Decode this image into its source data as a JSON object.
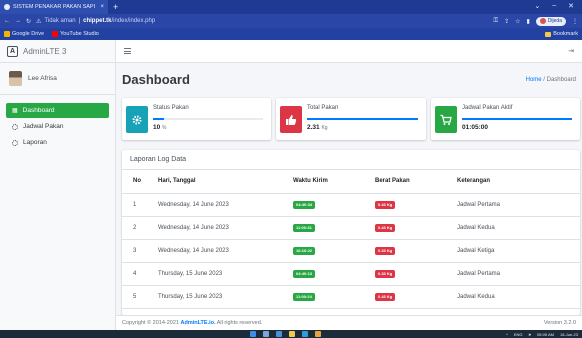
{
  "browser": {
    "tab_title": "SISTEM PENAKAR PAKAN SAPI",
    "tab_close": "×",
    "new_tab": "+",
    "url_secure": "Tidak aman",
    "url_host": "chippet.tk",
    "url_path": "/index/index.php",
    "profile_label": "Dijeda",
    "bookmarks": [
      {
        "label": "Google Drive",
        "icon": "google-drive-icon",
        "color": "#f4b400"
      },
      {
        "label": "YouTube Studio",
        "icon": "youtube-icon",
        "color": "#ff0000"
      }
    ],
    "bookmarks_right": "Bookmark"
  },
  "brand": {
    "logo_letter": "A",
    "name": "AdminLTE 3"
  },
  "user": {
    "name": "Lee Afrisa"
  },
  "menu": [
    {
      "label": "Dashboard",
      "active": true
    },
    {
      "label": "Jadwal Pakan",
      "active": false
    },
    {
      "label": "Laporan",
      "active": false
    }
  ],
  "header": {
    "title": "Dashboard",
    "breadcrumb_home": "Home",
    "breadcrumb_sep": "/",
    "breadcrumb_current": "Dashboard"
  },
  "info_boxes": [
    {
      "label": "Status Pakan",
      "value": "10",
      "unit": "%",
      "color": "#17a2b8",
      "icon": "gear-icon",
      "progress": 0.1
    },
    {
      "label": "Total Pakan",
      "value": "2.31",
      "unit": "Kg",
      "color": "#dc3545",
      "icon": "thumbs-up-icon",
      "progress": 1.0
    },
    {
      "label": "Jadwal Pakan Aktif",
      "value": "01:05:00",
      "unit": "",
      "color": "#28a745",
      "icon": "cart-icon",
      "progress": 1.0
    }
  ],
  "log": {
    "title": "Laporan Log Data",
    "columns": [
      "No",
      "Hari, Tanggal",
      "Waktu Kirim",
      "Berat Pakan",
      "Keterangan"
    ],
    "rows": [
      {
        "no": "1",
        "date": "Wednesday, 14 June 2023",
        "time": "04:40:34",
        "weight": "0.43 Kg",
        "note": "Jadwal Pertama"
      },
      {
        "no": "2",
        "date": "Wednesday, 14 June 2023",
        "time": "11:00:31",
        "weight": "0.43 Kg",
        "note": "Jadwal Kedua"
      },
      {
        "no": "3",
        "date": "Wednesday, 14 June 2023",
        "time": "16:10:22",
        "weight": "0.33 Kg",
        "note": "Jadwal Ketiga"
      },
      {
        "no": "4",
        "date": "Thursday, 15 June 2023",
        "time": "04:40:13",
        "weight": "0.33 Kg",
        "note": "Jadwal Pertama"
      },
      {
        "no": "5",
        "date": "Thursday, 15 June 2023",
        "time": "11:00:24",
        "weight": "0.43 Kg",
        "note": "Jadwal Kedua"
      }
    ]
  },
  "footer": {
    "copyright": "Copyright © 2014-2021",
    "brand": "AdminLTE.io.",
    "rights": "All rights reserved.",
    "version": "Version 3.2.0"
  },
  "taskbar": {
    "time": "05:05 AM",
    "date": "16-Jun-23",
    "lang": "ENG"
  }
}
